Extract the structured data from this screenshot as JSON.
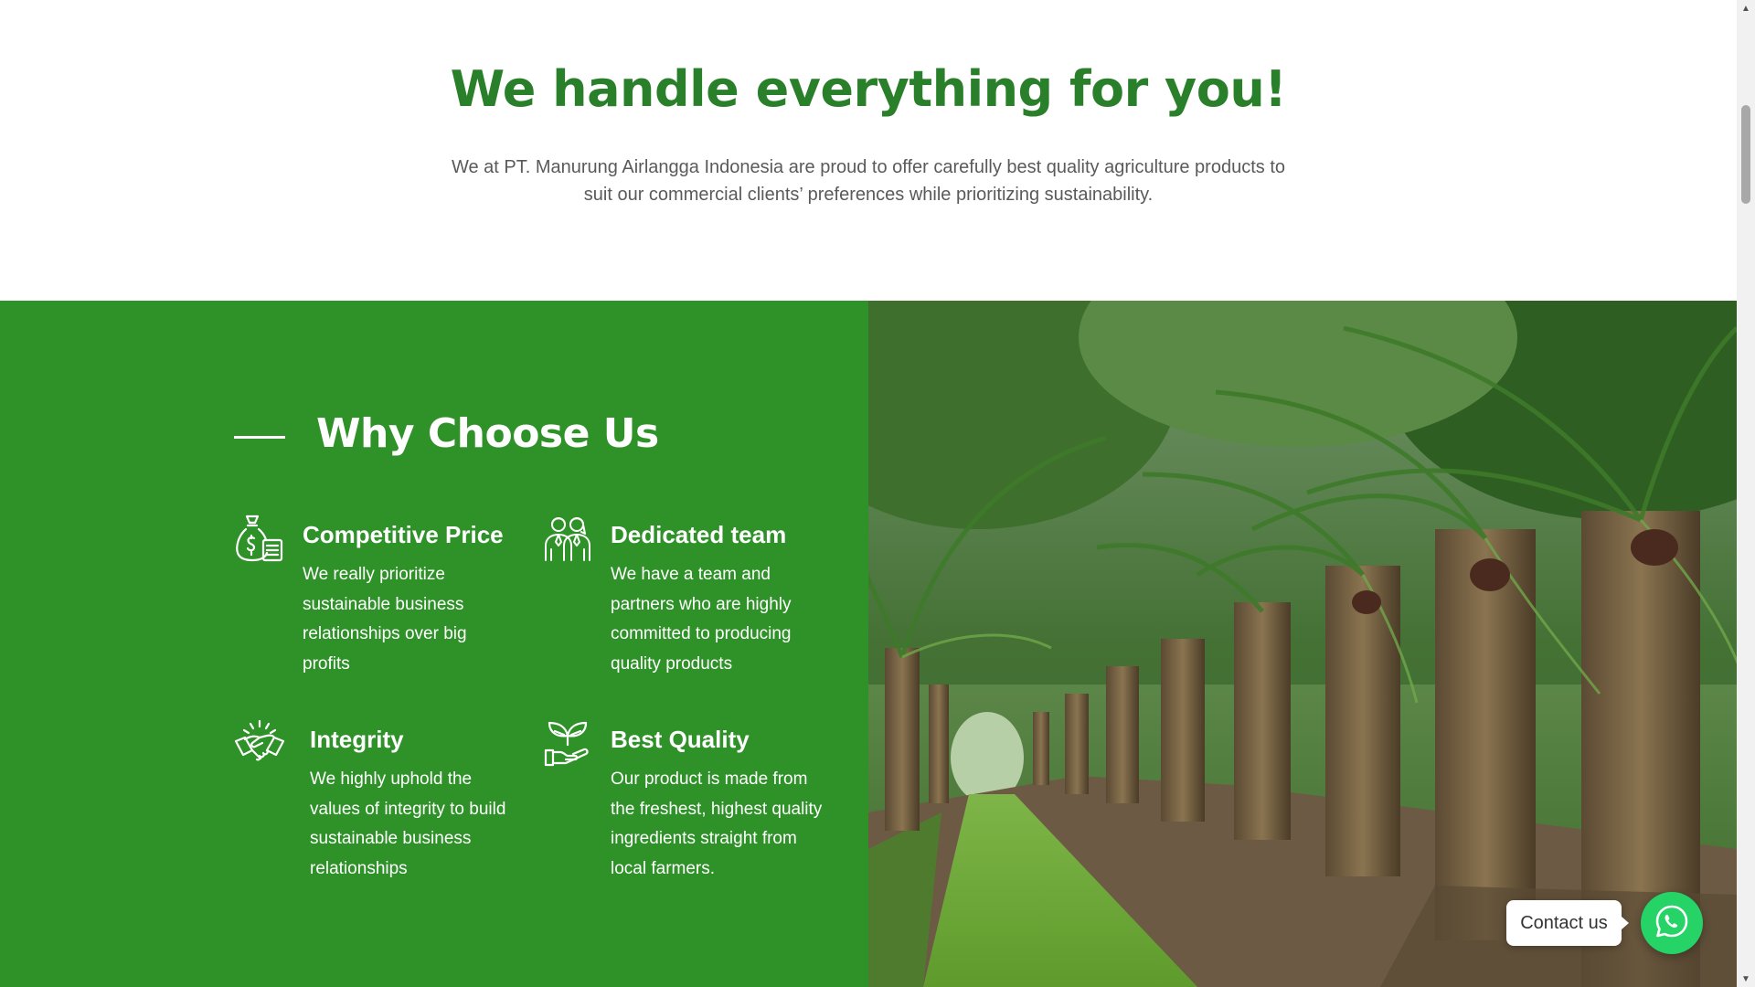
{
  "intro": {
    "title": "We handle everything for you!",
    "description": "We at PT. Manurung Airlangga Indonesia are proud to offer carefully best quality agriculture products to suit our commercial clients’ preferences while prioritizing sustainability."
  },
  "why": {
    "heading": "Why Choose Us",
    "features": [
      {
        "icon": "money-bag-icon",
        "title": "Competitive Price",
        "text": "We really prioritize sustainable business relationships over big profits"
      },
      {
        "icon": "team-icon",
        "title": "Dedicated team",
        "text": "We have a team and partners who are highly committed to producing quality products"
      },
      {
        "icon": "handshake-icon",
        "title": "Integrity",
        "text": "We highly uphold the values of integrity to build sustainable business relationships"
      },
      {
        "icon": "plant-hand-icon",
        "title": "Best Quality",
        "text": "Our product is made from the freshest, highest quality ingredients straight from local farmers."
      }
    ]
  },
  "photo": {
    "subject": "palm-plantation-photo"
  },
  "contact": {
    "label": "Contact us",
    "icon": "whatsapp-icon"
  },
  "colors": {
    "brand_green": "#2a7f2a",
    "panel_green": "#2f9229",
    "whatsapp": "#25d366"
  }
}
